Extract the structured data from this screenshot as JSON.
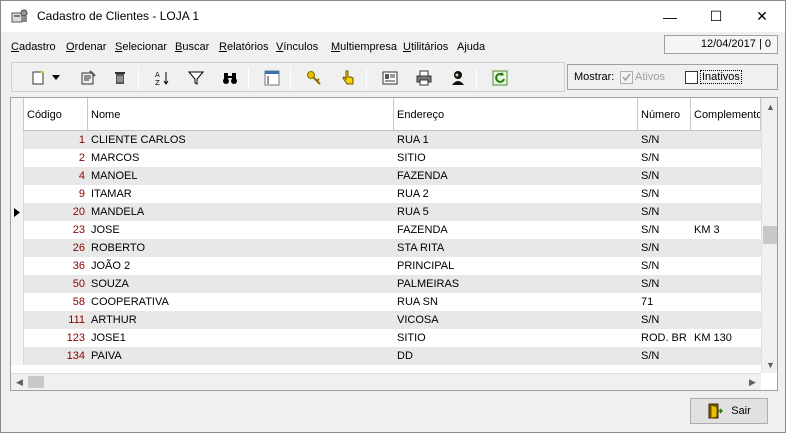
{
  "window": {
    "title": "Cadastro de Clientes - LOJA 1",
    "minimize": "—",
    "maximize": "☐",
    "close": "✕"
  },
  "menu": [
    {
      "label": "Cadastro",
      "ul": "C",
      "rest": "adastro"
    },
    {
      "label": "Ordenar",
      "ul": "O",
      "rest": "rdenar"
    },
    {
      "label": "Selecionar",
      "ul": "S",
      "rest": "elecionar"
    },
    {
      "label": "Buscar",
      "ul": "B",
      "rest": "uscar"
    },
    {
      "label": "Relatórios",
      "ul": "R",
      "rest": "elatórios"
    },
    {
      "label": "Vínculos",
      "ul": "V",
      "rest": "ínculos"
    },
    {
      "label": "Multiempresa",
      "ul": "M",
      "rest": "ultiempresa"
    },
    {
      "label": "Utilitários",
      "ul": "U",
      "rest": "tilitários"
    },
    {
      "label": "Ajuda",
      "ul": "",
      "rest": "Ajuda"
    }
  ],
  "status_box": "12/04/2017 | 0",
  "toolbar": {
    "icons": [
      "new-record-icon",
      "dropdown-arrow-icon",
      "edit-record-icon",
      "delete-icon",
      "sort-az-icon",
      "filter-icon",
      "binoculars-search-icon",
      "columns-icon",
      "key-icon",
      "hand-pointer-icon",
      "card-icon",
      "printer-icon",
      "person-icon",
      "refresh-icon"
    ]
  },
  "filter": {
    "label": "Mostrar:",
    "ativos_label": "Ativos",
    "ativos_checked": true,
    "inativos_label": "Inativos",
    "inativos_checked": false
  },
  "grid": {
    "columns": [
      "Código",
      "Nome",
      "Endereço",
      "Número",
      "Complemento"
    ],
    "current_row_index": 4,
    "rows": [
      {
        "codigo": "1",
        "nome": "CLIENTE CARLOS",
        "endereco": "RUA 1",
        "numero": "S/N",
        "complemento": ""
      },
      {
        "codigo": "2",
        "nome": "MARCOS",
        "endereco": "SITIO",
        "numero": "S/N",
        "complemento": ""
      },
      {
        "codigo": "4",
        "nome": "MANOEL",
        "endereco": "FAZENDA",
        "numero": "S/N",
        "complemento": ""
      },
      {
        "codigo": "9",
        "nome": "ITAMAR",
        "endereco": "RUA 2",
        "numero": "S/N",
        "complemento": ""
      },
      {
        "codigo": "20",
        "nome": "MANDELA",
        "endereco": "RUA 5",
        "numero": "S/N",
        "complemento": ""
      },
      {
        "codigo": "23",
        "nome": "JOSE",
        "endereco": "FAZENDA",
        "numero": "S/N",
        "complemento": "KM 3"
      },
      {
        "codigo": "26",
        "nome": "ROBERTO",
        "endereco": "STA RITA",
        "numero": "S/N",
        "complemento": ""
      },
      {
        "codigo": "36",
        "nome": "JOÃO 2",
        "endereco": "PRINCIPAL",
        "numero": "S/N",
        "complemento": ""
      },
      {
        "codigo": "50",
        "nome": "SOUZA",
        "endereco": "PALMEIRAS",
        "numero": "S/N",
        "complemento": ""
      },
      {
        "codigo": "58",
        "nome": "COOPERATIVA",
        "endereco": "RUA SN",
        "numero": "71",
        "complemento": ""
      },
      {
        "codigo": "111",
        "nome": "ARTHUR",
        "endereco": "VICOSA",
        "numero": "S/N",
        "complemento": ""
      },
      {
        "codigo": "123",
        "nome": "JOSE1",
        "endereco": "SITIO",
        "numero": "ROD. BR",
        "complemento": "KM 130"
      },
      {
        "codigo": "134",
        "nome": "PAIVA",
        "endereco": "DD",
        "numero": "S/N",
        "complemento": ""
      }
    ]
  },
  "buttons": {
    "sair": "Sair"
  }
}
